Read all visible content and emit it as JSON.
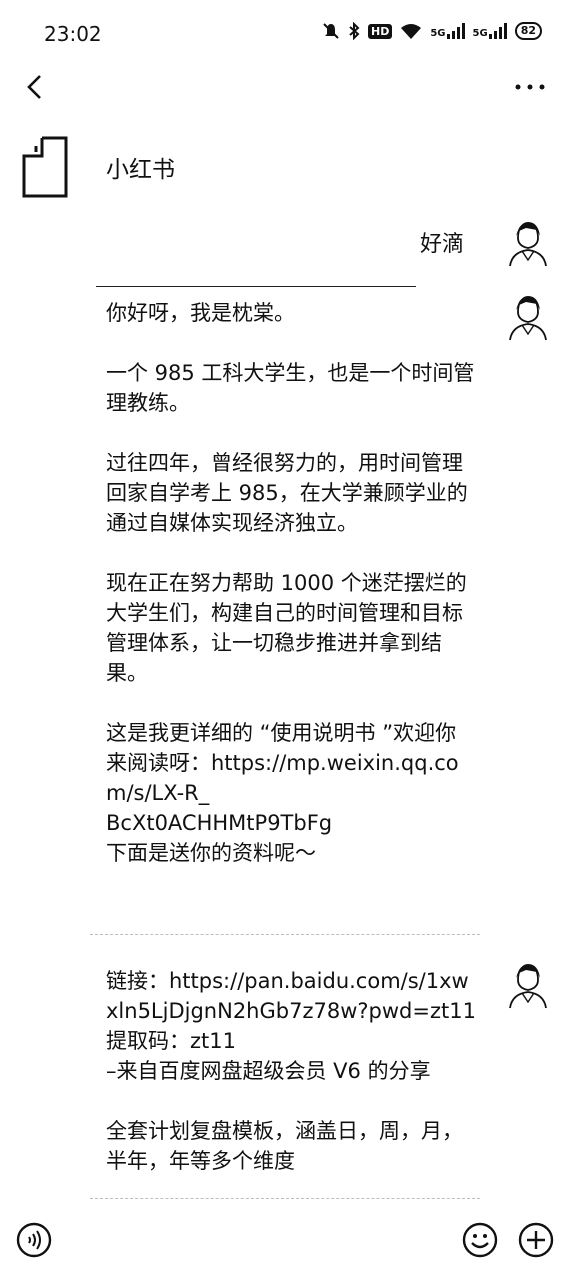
{
  "status_bar": {
    "time": "23:02",
    "signal_label_1": "5G",
    "signal_label_2": "5G",
    "hd_label": "HD",
    "battery": "82"
  },
  "nav": {
    "back_icon": "chevron-left-icon",
    "more_icon": "more-horizontal-icon"
  },
  "chat": {
    "contact_name": "小红书",
    "reply_text": "好滴",
    "message_1": "你好呀，我是枕棠。\n\n一个 985 工科大学生，也是一个时间管理教练。\n\n过往四年，曾经很努力的，用时间管理回家自学考上 985，在大学兼顾学业的通过自媒体实现经济独立。\n\n现在正在努力帮助 1000 个迷茫摆烂的大学生们，构建自己的时间管理和目标管理体系，让一切稳步推进并拿到结果。\n\n这是我更详细的 “使用说明书 ”欢迎你来阅读呀：https://mp.weixin.qq.com/s/LX-R_\nBcXt0ACHHMtP9TbFg\n下面是送你的资料呢～",
    "message_2": "链接：https://pan.baidu.com/s/1xwxln5LjDjgnN2hGb7z78w?pwd=zt11\n提取码：zt11\n–来自百度网盘超级会员 V6 的分享\n\n全套计划复盘模板，涵盖日，周，月，半年，年等多个维度"
  },
  "bottom_bar": {
    "voice_icon": "voice-input-icon",
    "emoji_icon": "emoji-icon",
    "plus_icon": "plus-circle-icon"
  }
}
